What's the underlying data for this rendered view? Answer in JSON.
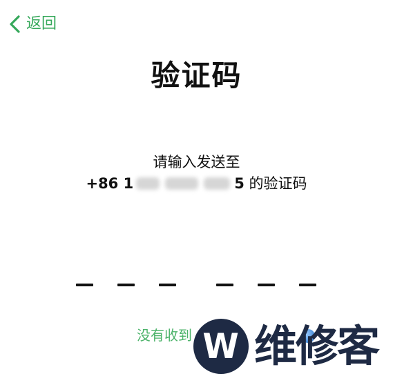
{
  "nav": {
    "back_icon": "chevron-left-icon",
    "back_label": "返回"
  },
  "title": "验证码",
  "prompt": {
    "line1": "请输入发送至",
    "phone_prefix": "+86 1",
    "phone_suffix": "5",
    "tail": " 的验证码"
  },
  "resend": {
    "label": "没有收到"
  },
  "watermark": {
    "mark": "W",
    "text": "维修客",
    "icon": "globe-icon"
  },
  "colors": {
    "accent": "#35a85a",
    "link": "#4cb36a",
    "text": "#111111",
    "watermark": "#1e2a44"
  }
}
